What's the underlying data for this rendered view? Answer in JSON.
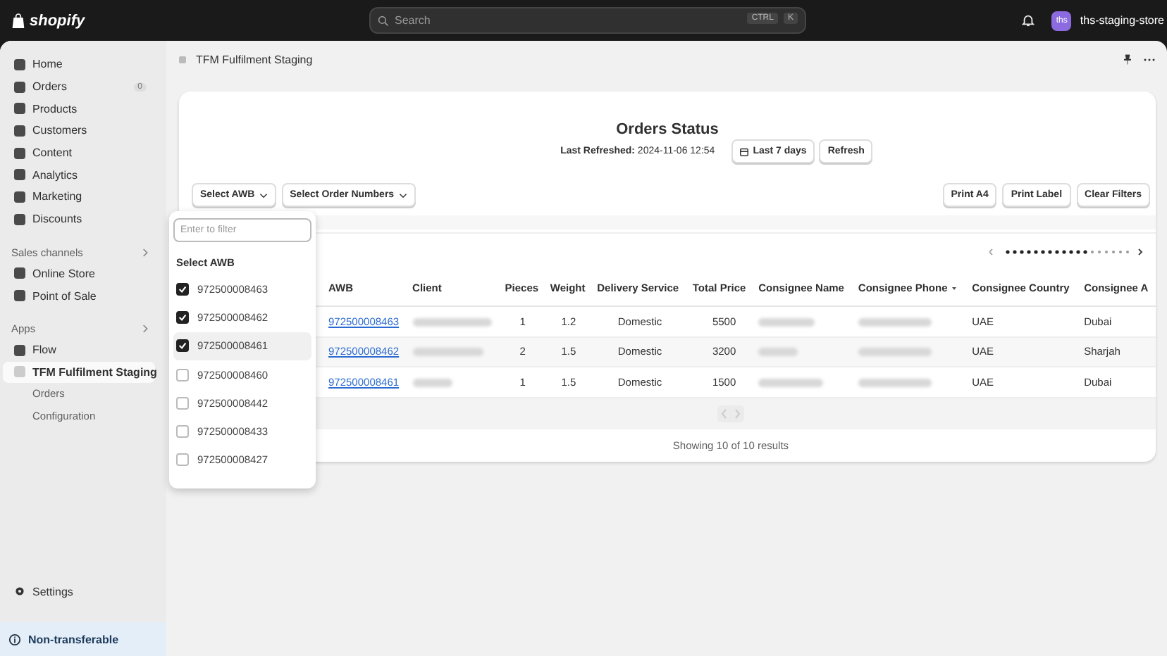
{
  "topbar": {
    "logo": "shopify",
    "search": {
      "placeholder": "Search",
      "keys": [
        "CTRL",
        "K"
      ]
    },
    "store": {
      "initials": "ths",
      "name": "ths-staging-store"
    }
  },
  "sidebar": {
    "items": [
      {
        "label": "Home",
        "selected": false
      },
      {
        "label": "Orders",
        "badge": "0",
        "selected": false
      },
      {
        "label": "Products",
        "selected": false
      },
      {
        "label": "Customers",
        "selected": false
      },
      {
        "label": "Content",
        "selected": false
      },
      {
        "label": "Analytics",
        "selected": false
      },
      {
        "label": "Marketing",
        "selected": false
      },
      {
        "label": "Discounts",
        "selected": false
      }
    ],
    "sections": [
      {
        "title": "Sales channels",
        "items": [
          {
            "label": "Online Store",
            "selected": false
          },
          {
            "label": "Point of Sale",
            "selected": false
          }
        ]
      },
      {
        "title": "Apps",
        "items": [
          {
            "label": "Flow",
            "selected": false
          },
          {
            "label": "TFM Fulfilment Staging",
            "selected": true,
            "children": [
              {
                "label": "Orders",
                "selected": false
              },
              {
                "label": "Configuration",
                "selected": false
              }
            ]
          }
        ]
      }
    ],
    "settings": "Settings",
    "notice": "Non-transferable"
  },
  "page": {
    "title": "TFM Fulfilment Staging"
  },
  "card": {
    "title": "Orders Status",
    "refreshed_label": "Last Refreshed:",
    "refreshed_value": "2024-11-06 12:54",
    "range_button": "Last 7 days",
    "refresh_button": "Refresh",
    "filters": [
      "Select AWB",
      "Select Order Numbers"
    ],
    "actions": [
      "Print A4",
      "Print Label",
      "Clear Filters"
    ],
    "awb_dropdown": {
      "placeholder": "Enter to filter",
      "heading": "Select AWB",
      "options": [
        {
          "label": "972500008463",
          "checked": true,
          "highlighted": false
        },
        {
          "label": "972500008462",
          "checked": true,
          "highlighted": false
        },
        {
          "label": "972500008461",
          "checked": true,
          "highlighted": true
        },
        {
          "label": "972500008460",
          "checked": false,
          "highlighted": false
        },
        {
          "label": "972500008442",
          "checked": false,
          "highlighted": false
        },
        {
          "label": "972500008433",
          "checked": false,
          "highlighted": false
        },
        {
          "label": "972500008427",
          "checked": false,
          "highlighted": false
        }
      ]
    },
    "table": {
      "columns": [
        "AWB",
        "Client",
        "Pieces",
        "Weight",
        "Delivery Service",
        "Total Price",
        "Consignee Name",
        "Consignee Phone",
        "Consignee Country",
        "Consignee A"
      ],
      "rows": [
        {
          "awb": "972500008463",
          "pieces": "1",
          "weight": "1.2",
          "service": "Domestic",
          "price": "5500",
          "country": "UAE",
          "city": "Dubai"
        },
        {
          "awb": "972500008462",
          "pieces": "2",
          "weight": "1.5",
          "service": "Domestic",
          "price": "3200",
          "country": "UAE",
          "city": "Sharjah"
        },
        {
          "awb": "972500008461",
          "pieces": "1",
          "weight": "1.5",
          "service": "Domestic",
          "price": "1500",
          "country": "UAE",
          "city": "Dubai"
        }
      ]
    },
    "footer": "Showing 10 of 10 results"
  }
}
